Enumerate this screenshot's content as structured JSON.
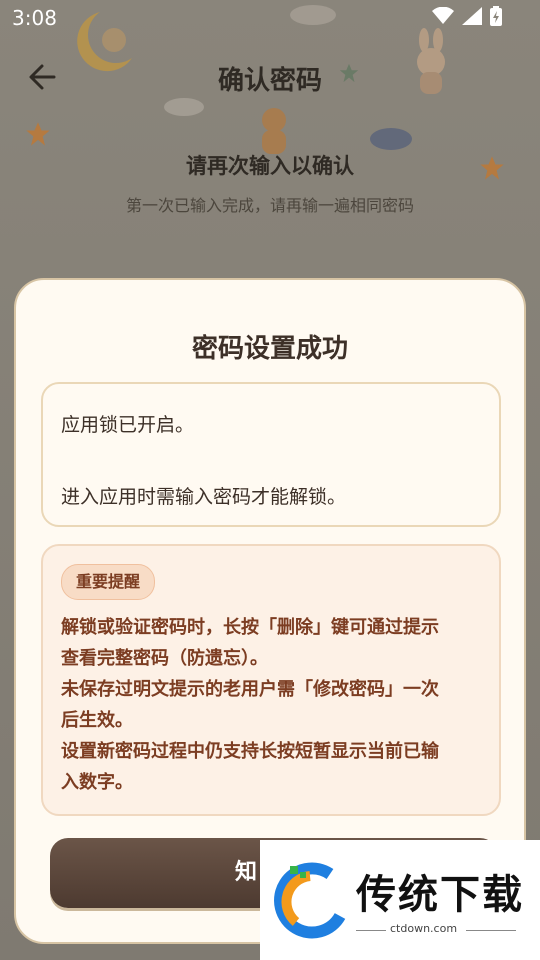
{
  "status_bar": {
    "time": "3:08"
  },
  "background_page": {
    "title": "确认密码",
    "heading": "请再次输入以确认",
    "subtitle": "第一次已输入完成，请再输一遍相同密码"
  },
  "dialog": {
    "title": "密码设置成功",
    "info": {
      "line1": "应用锁已开启。",
      "line2": "进入应用时需输入密码才能解锁。"
    },
    "warning": {
      "badge": "重要提醒",
      "lines": [
        "解锁或验证密码时，长按「删除」键可通过提示",
        "查看完整密码（防遗忘）。",
        "未保存过明文提示的老用户需「修改密码」一次",
        "后生效。",
        "设置新密码过程中仍支持长按短暂显示当前已输",
        "入数字。"
      ]
    },
    "confirm_button": "知"
  },
  "watermark": {
    "text": "传统下载",
    "url": "ctdown.com"
  },
  "colors": {
    "dialog_bg": "#fffaf2",
    "accent_brown": "#5a4538",
    "warning_text": "#7c3d22"
  }
}
